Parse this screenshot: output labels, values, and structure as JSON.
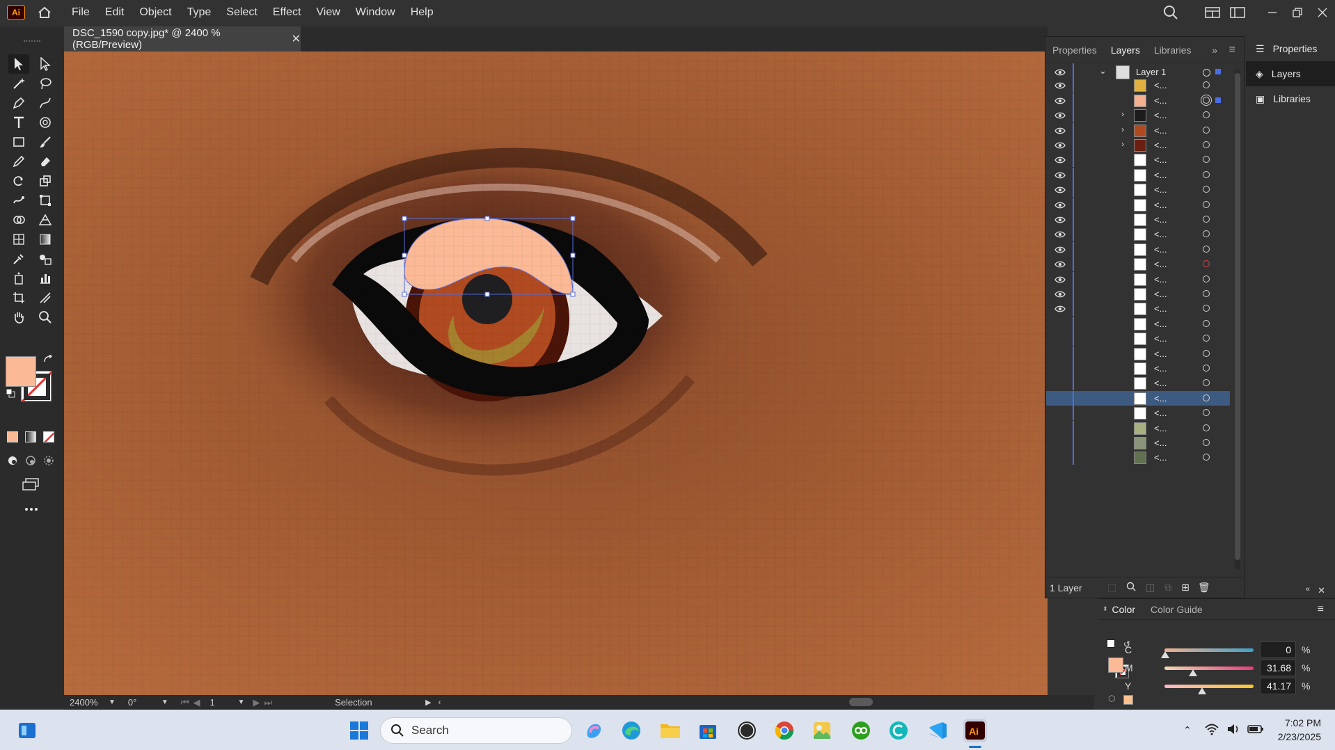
{
  "app": {
    "logo_text": "Ai"
  },
  "menu": [
    "File",
    "Edit",
    "Object",
    "Type",
    "Select",
    "Effect",
    "View",
    "Window",
    "Help"
  ],
  "document": {
    "tab_title": "DSC_1590 copy.jpg* @ 2400 % (RGB/Preview)",
    "close_glyph": "✕"
  },
  "status": {
    "zoom": "2400%",
    "rotation": "0°",
    "artboard": "1",
    "tool": "Selection"
  },
  "panel": {
    "tabs": [
      "Properties",
      "Layers",
      "Libraries"
    ],
    "active_tab": "Layers",
    "layer_name": "Layer 1",
    "footer_label": "1 Layer",
    "sublayer_label": "<...",
    "sublayers": [
      {
        "thumb": "#e0b040",
        "expand": false
      },
      {
        "thumb": "#f4b090",
        "expand": false
      },
      {
        "thumb": "#1c1c1c",
        "expand": true
      },
      {
        "thumb": "#b04a20",
        "expand": true
      },
      {
        "thumb": "#6a2010",
        "expand": true
      },
      {
        "thumb": "#ffffff",
        "expand": false
      },
      {
        "thumb": "#ffffff",
        "expand": false
      },
      {
        "thumb": "#ffffff",
        "expand": false
      },
      {
        "thumb": "#ffffff",
        "expand": false
      },
      {
        "thumb": "#ffffff",
        "expand": false
      },
      {
        "thumb": "#ffffff",
        "expand": false
      },
      {
        "thumb": "#ffffff",
        "expand": false
      },
      {
        "thumb": "#ffffff",
        "expand": false
      },
      {
        "thumb": "#ffffff",
        "expand": false
      },
      {
        "thumb": "#ffffff",
        "expand": false
      },
      {
        "thumb": "#ffffff",
        "expand": false
      },
      {
        "thumb": "#ffffff",
        "expand": false
      },
      {
        "thumb": "#ffffff",
        "expand": false
      },
      {
        "thumb": "#ffffff",
        "expand": false
      },
      {
        "thumb": "#ffffff",
        "expand": false
      },
      {
        "thumb": "#ffffff",
        "expand": false
      },
      {
        "thumb": "#ffffff",
        "expand": false
      },
      {
        "thumb": "#ffffff",
        "expand": false
      },
      {
        "thumb": "#a8b080",
        "expand": false
      },
      {
        "thumb": "#8a9478",
        "expand": false
      },
      {
        "thumb": "#607050",
        "expand": false
      }
    ]
  },
  "dock": [
    "Properties",
    "Layers",
    "Libraries"
  ],
  "color": {
    "tabs": [
      "Color",
      "Color Guide"
    ],
    "fill_hex": "#FBB996",
    "channels": [
      {
        "label": "C",
        "value": "0",
        "unit": "%"
      },
      {
        "label": "M",
        "value": "31.68",
        "unit": "%"
      },
      {
        "label": "Y",
        "value": "41.17",
        "unit": "%"
      }
    ]
  },
  "taskbar": {
    "search_placeholder": "Search",
    "time": "7:02 PM",
    "date": "2/23/2025"
  }
}
